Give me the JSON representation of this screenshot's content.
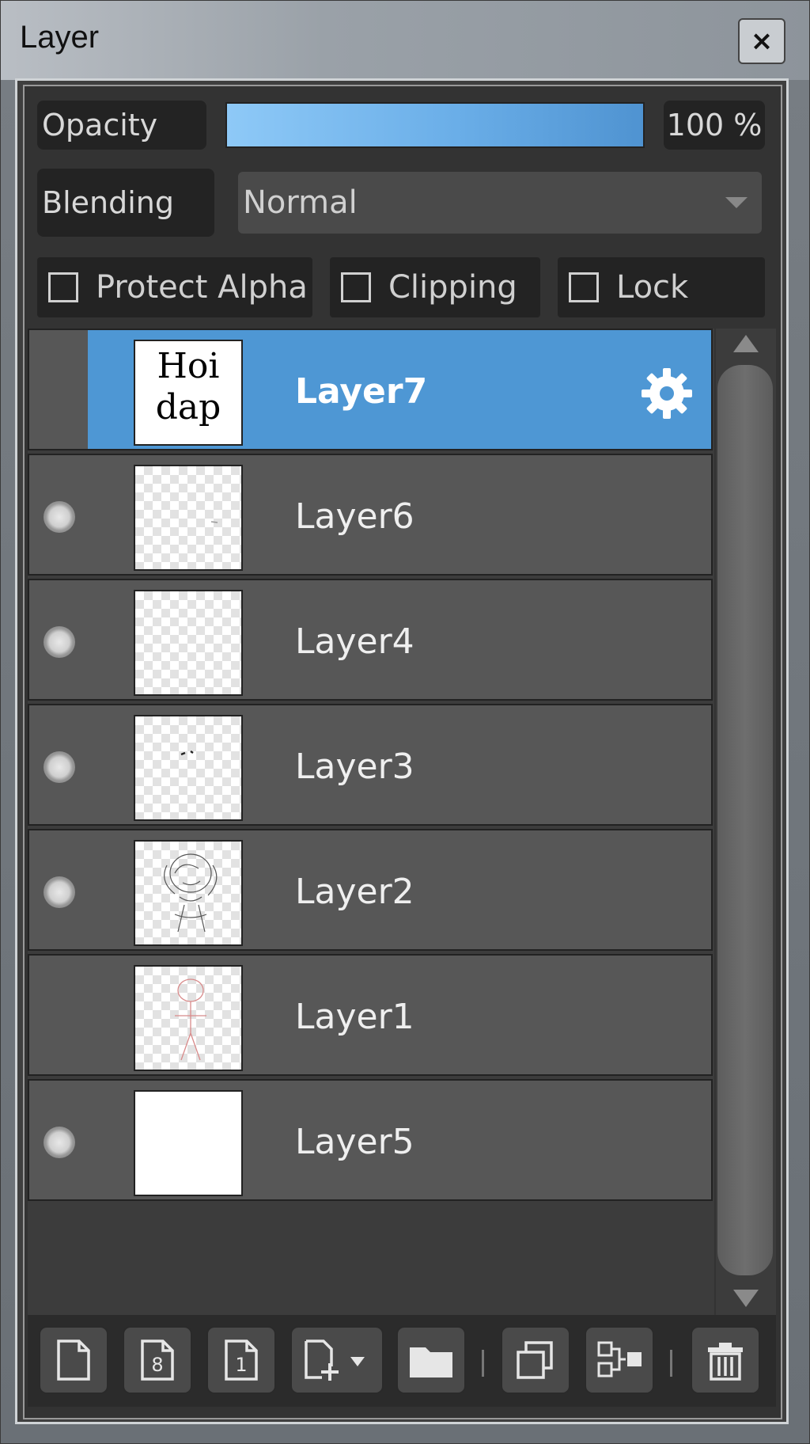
{
  "window": {
    "title": "Layer",
    "close_label": "×"
  },
  "opacity": {
    "label": "Opacity",
    "value": 100,
    "value_text": "100 %",
    "fill_fraction": 1.0
  },
  "blending": {
    "label": "Blending",
    "selected": "Normal"
  },
  "checkboxes": [
    {
      "label": "Protect Alpha",
      "checked": false
    },
    {
      "label": "Clipping",
      "checked": false
    },
    {
      "label": "Lock",
      "checked": false
    }
  ],
  "layers": [
    {
      "name": "Layer7",
      "selected": true,
      "visible": false,
      "thumb": "handwriting",
      "thumb_text": "Hoi\ndap",
      "has_settings": true
    },
    {
      "name": "Layer6",
      "selected": false,
      "visible": true,
      "thumb": "transparent"
    },
    {
      "name": "Layer4",
      "selected": false,
      "visible": true,
      "thumb": "transparent"
    },
    {
      "name": "Layer3",
      "selected": false,
      "visible": true,
      "thumb": "transparent"
    },
    {
      "name": "Layer2",
      "selected": false,
      "visible": true,
      "thumb": "sketch"
    },
    {
      "name": "Layer1",
      "selected": false,
      "visible": false,
      "thumb": "red-sketch"
    },
    {
      "name": "Layer5",
      "selected": false,
      "visible": true,
      "thumb": "white"
    }
  ],
  "toolbar": [
    {
      "icon": "new-layer-icon"
    },
    {
      "icon": "new-8bit-layer-icon"
    },
    {
      "icon": "new-1bit-layer-icon"
    },
    {
      "icon": "add-layer-menu-icon"
    },
    {
      "icon": "folder-icon"
    },
    {
      "icon": "duplicate-layer-icon"
    },
    {
      "icon": "merge-layer-icon"
    },
    {
      "icon": "delete-layer-icon"
    }
  ],
  "colors": {
    "accent": "#4e97d4",
    "row": "#575757",
    "panel": "#333333"
  }
}
